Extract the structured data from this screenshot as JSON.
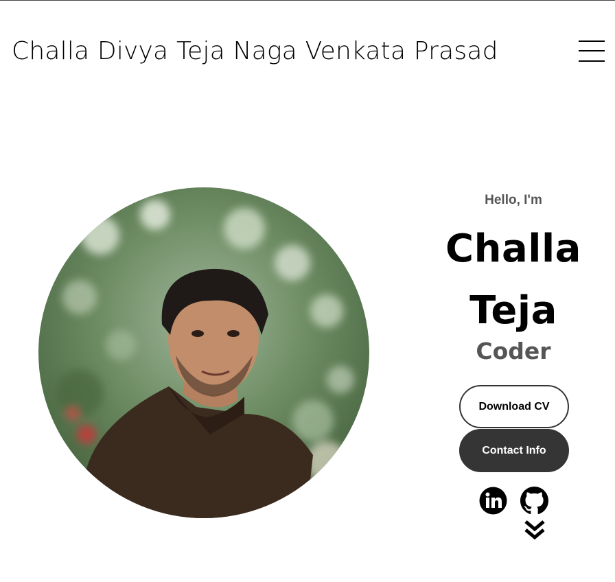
{
  "header": {
    "title": "Challa Divya Teja Naga Venkata Prasad",
    "menu_icon": "hamburger-menu-icon"
  },
  "hero": {
    "greeting": "Hello, I'm",
    "name_line1": "Challa",
    "name_line2": "Teja",
    "role": "Coder",
    "download_cv_label": "Download CV",
    "contact_info_label": "Contact Info",
    "profile_image": "profile-picture",
    "social": [
      {
        "icon": "linkedin-icon"
      },
      {
        "icon": "github-icon"
      }
    ],
    "scroll_icon": "double-chevron-down-icon"
  },
  "colors": {
    "text": "#000000",
    "muted": "#555555",
    "button_dark": "#353535",
    "background": "#ffffff"
  }
}
